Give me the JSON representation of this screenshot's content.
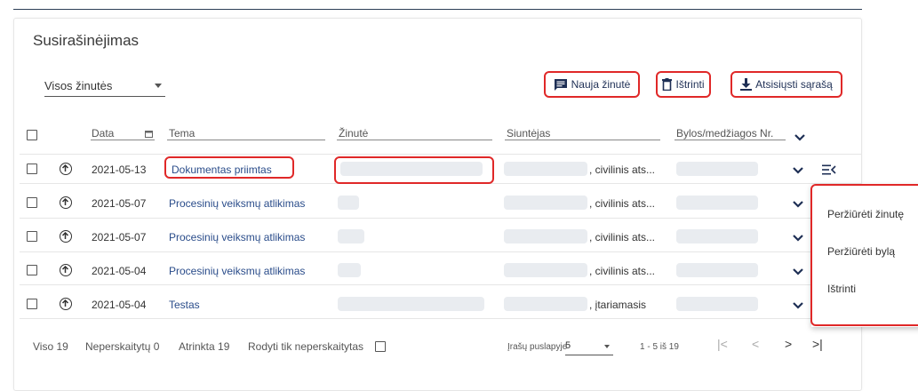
{
  "panel": {
    "title": "Susirašinėjimas",
    "filter_value": "Visos žinutės"
  },
  "toolbar": {
    "new_message": "Nauja žinutė",
    "delete": "Ištrinti",
    "download_list": "Atsisiųsti sąrašą"
  },
  "columns": {
    "date": "Data",
    "subject": "Tema",
    "message": "Žinutė",
    "sender": "Siuntėjas",
    "case_no": "Bylos/medžiagos Nr."
  },
  "rows": [
    {
      "date": "2021-05-13",
      "subject": "Dokumentas priimtas",
      "sender_suffix": ", civilinis ats..."
    },
    {
      "date": "2021-05-07",
      "subject": "Procesinių veiksmų atlikimas",
      "sender_suffix": ", civilinis ats..."
    },
    {
      "date": "2021-05-07",
      "subject": "Procesinių veiksmų atlikimas",
      "sender_suffix": ", civilinis ats..."
    },
    {
      "date": "2021-05-04",
      "subject": "Procesinių veiksmų atlikimas",
      "sender_suffix": ", civilinis ats..."
    },
    {
      "date": "2021-05-04",
      "subject": "Testas",
      "sender_suffix": ", įtariamasis"
    }
  ],
  "context_menu": {
    "view_message": "Peržiūrėti žinutę",
    "view_case": "Peržiūrėti bylą",
    "delete": "Ištrinti"
  },
  "footer": {
    "total": "Viso 19",
    "unread": "Neperskaitytų 0",
    "selected": "Atrinkta 19",
    "unread_only": "Rodyti tik neperskaitytas",
    "per_page_label": "Įrašų puslapyje",
    "per_page_value": "5",
    "range": "1 - 5 iš 19"
  },
  "icons": {
    "first": "|<",
    "prev": "<",
    "next": ">",
    "last": ">|"
  },
  "colors": {
    "accent": "#1e2f55",
    "link": "#2a4c8a",
    "highlight": "#e02828"
  }
}
